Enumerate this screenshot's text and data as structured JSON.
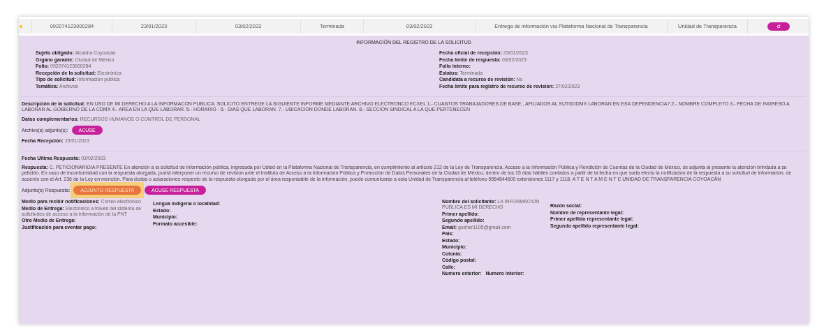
{
  "table": {
    "row": {
      "cells": [
        "092074123000284",
        "23/01/2023",
        "03/02/2023",
        "Terminada",
        "03/02/2023",
        "Entrega de información vía Plataforma Nacional de Transparencia",
        "Unidad de Transparencia"
      ]
    }
  },
  "detail": {
    "title": "INFORMACIÓN DEL REGISTRO DE LA SOLICITUD",
    "left_fields": [
      {
        "label": "Sujeto obligado:",
        "value": "Alcaldía Coyoacán"
      },
      {
        "label": "Organo garante:",
        "value": "Ciudad de México"
      },
      {
        "label": "Folio:",
        "value": "092074123000284"
      },
      {
        "label": "Recepción de la solicitud:",
        "value": "Electrónica"
      },
      {
        "label": "Tipo de solicitud:",
        "value": "Información pública"
      },
      {
        "label": "Temática:",
        "value": "Archivos"
      }
    ],
    "right_fields": [
      {
        "label": "Fecha oficial de recepción:",
        "value": "23/01/2023"
      },
      {
        "label": "Fecha límite de respuesta:",
        "value": "03/02/2023"
      },
      {
        "label": "Folio interno:"
      },
      {
        "label": "Estatus:",
        "value": "Terminada"
      },
      {
        "label": "Candidata a recurso de revisión:",
        "value": "No"
      },
      {
        "label": "Fecha límite para registro de recurso de revisión:",
        "value": "27/02/2023"
      }
    ],
    "description": {
      "label": "Descripción de la solicitud:",
      "value": "EN USO DE MI DERECHO A LA INFORMACON PUBLICA. SOLICITO ENTREGE LA SIGUIENTE INFORME MEDIANTE ARCHIVO ELECTRONCO ECXEL 1.- CUANTOS TRABAJADORES DE BASE , AFILIADOS AL SUTGDDMX LABORAN EN ESA DEPENDENCIA? 2.- NOMBRE COMPLETO 3.- FECHA DE INGRESO A LABORAR AL GOBIERNO DE LA CDMX 4.- AREA EN LA QUE LABORAR. 5.- HORARIO - 6.- DIAS QUE LABORAN. 7.- UBICACION DONDE LABORAN. 8.- SECCION SINDICAL A LA QUE PERTENECEN"
    },
    "complementary": {
      "label": "Datos complementarios:",
      "value": "RECURSOS HUMANOS O CONTROL DE PERSONAL"
    },
    "attachments": {
      "label": "Archivo(s) adjunto(s):",
      "buttons": [
        {
          "label": "ACUSE",
          "kind": "primary",
          "highlighted": false
        }
      ]
    },
    "reception": {
      "label": "Fecha Recepción:",
      "value": "23/01/2023"
    },
    "last_response": {
      "label": "Fecha Ultima Respuesta:",
      "value": "03/02/2023"
    },
    "response": {
      "label": "Respuesta:",
      "value": "C. PETICIONARIO/A PRESENTE En atención a la solicitud de información pública, ingresada por Usted en la Plataforma Nacional de Transparencia, en cumplimiento al artículo 212 de la Ley de Transparencia, Acceso a la Información Pública y Rendición de Cuentas de la Ciudad de México, se adjunta al presente la atención brindada a su petición. En caso de inconformidad con la respuesta otorgada, podrá interponer un recurso de revisión ante el Instituto de Acceso a la Información Pública y Protección de Datos Personales de la Ciudad de México, dentro de los 15 días hábiles contados a partir de la fecha en que surta efecto la notificación de la respuesta a su solicitud de información, de acuerdo con el Art. 236 de la Ley en mención. Para dudas o aclaraciones respecto de la respuesta otorgada por el área responsable de la información, puede comunicarse a esta Unidad de Transparencia al teléfono 5554844500 extensiones 1117 y 1118. A T E N T A M E N T E UNIDAD DE TRANSPARENCIA COYOACÁN"
    },
    "response_attachments": {
      "label": "Adjunto(s) Respuesta:",
      "buttons": [
        {
          "label": "ADJUNTO RESPUESTA",
          "kind": "secondary",
          "highlighted": true
        },
        {
          "label": "ACUSE RESPUESTA",
          "kind": "primary",
          "highlighted": false
        }
      ]
    },
    "columns": [
      [
        {
          "label": "Medio para recibir notificaciones:",
          "value": "Correo electrónico"
        },
        {
          "label": "Medio de Entrega:",
          "value": "Electrónico a través del sistema de solicitudes de acceso a la información de la PNT"
        },
        {
          "label": "Otro Medio de Entrega:"
        },
        {
          "label": "Justificación para eventar pago:"
        }
      ],
      [
        {
          "label": "Lengua indígena o localidad:"
        },
        {
          "label": "Estado:"
        },
        {
          "label": "Municipio:"
        },
        {
          "label": "Formato accesible:"
        }
      ],
      [
        {
          "label": "Nombre del solicitante:",
          "value": "LA INFORMACION PUBLICA ES MI DERECHO"
        },
        {
          "label": "Primer apellido:"
        },
        {
          "label": "Segundo apellido:"
        },
        {
          "label": "Email:",
          "value": "gusher1105@gmail.com"
        },
        {
          "label": "País:"
        },
        {
          "label": "Estado:"
        },
        {
          "label": "Municipio:"
        },
        {
          "label": "Colonia:"
        },
        {
          "label": "Código postal:"
        },
        {
          "label": "Calle:"
        },
        {
          "kind": "pair",
          "labels": [
            "Numero exterior:",
            "Numero interior:"
          ]
        }
      ],
      [
        {
          "label": "Razón social:"
        },
        {
          "label": "Nombre de representante legal:"
        },
        {
          "label": "Primer apellido representante legal:"
        },
        {
          "label": "Segundo apellido representante legal:"
        }
      ]
    ]
  }
}
